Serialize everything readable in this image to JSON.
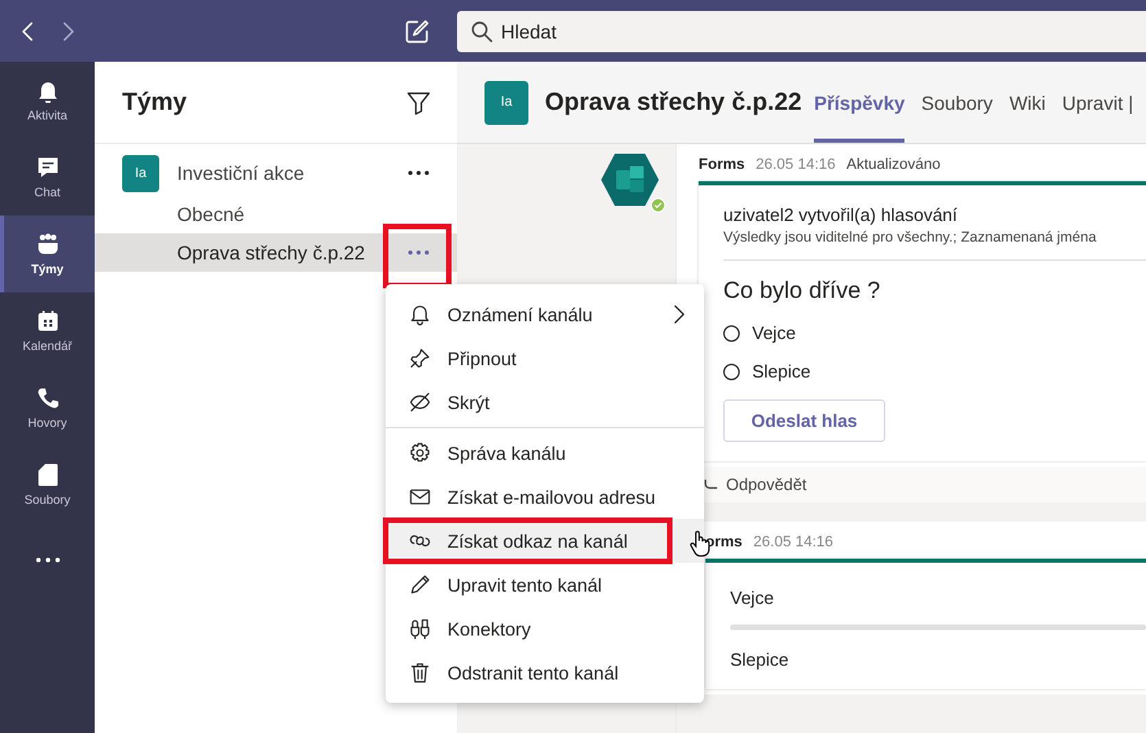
{
  "top_bar": {
    "search": {
      "placeholder": "Hledat"
    }
  },
  "rail": [
    {
      "kind": "activity",
      "label": "Aktivita",
      "selected": false
    },
    {
      "kind": "chat",
      "label": "Chat",
      "selected": false
    },
    {
      "kind": "teams",
      "label": "Týmy",
      "selected": true
    },
    {
      "kind": "calendar",
      "label": "Kalendář",
      "selected": false
    },
    {
      "kind": "calls",
      "label": "Hovory",
      "selected": false
    },
    {
      "kind": "files",
      "label": "Soubory",
      "selected": false
    }
  ],
  "teams_panel": {
    "title": "Týmy",
    "teams": [
      {
        "initials": "Ia",
        "name": "Investiční akce",
        "channels": [
          {
            "name": "Obecné",
            "selected": false,
            "annotated": false
          },
          {
            "name": "Oprava střechy č.p.22",
            "selected": true,
            "annotated": true
          }
        ]
      }
    ]
  },
  "channel_header": {
    "initials": "Ia",
    "title": "Oprava střechy č.p.22",
    "tabs": [
      {
        "label": "Příspěvky",
        "selected": true
      },
      {
        "label": "Soubory",
        "selected": false
      },
      {
        "label": "Wiki",
        "selected": false
      },
      {
        "label": "Upravit |",
        "selected": false
      }
    ]
  },
  "posts": [
    {
      "author": "Forms",
      "time": "26.05 14:16",
      "status": "Aktualizováno",
      "creator_line": "uzivatel2 vytvořil(a) hlasování",
      "note": "Výsledky jsou viditelné pro všechny.; Zaznamenaná jména",
      "question": "Co bylo dříve ?",
      "options": [
        {
          "label": "Vejce",
          "selected": false
        },
        {
          "label": "Slepice",
          "selected": false
        }
      ],
      "submit": "Odeslat hlas",
      "reply": "Odpovědět"
    },
    {
      "author": "orms",
      "time": "26.05 14:16",
      "results": [
        {
          "option": "Vejce",
          "level": 0
        },
        {
          "option": "Slepice"
        }
      ]
    }
  ],
  "context_menu": {
    "sections": [
      [
        {
          "kind": "notifications",
          "label": "Oznámení kanálu",
          "submenu": true,
          "hovered": false,
          "annotated": false
        },
        {
          "kind": "pin",
          "label": "Připnout",
          "submenu": false,
          "hovered": false,
          "annotated": false
        },
        {
          "kind": "hide",
          "label": "Skrýt",
          "submenu": false,
          "hovered": false,
          "annotated": false
        }
      ],
      [
        {
          "kind": "settings",
          "label": "Správa kanálu",
          "submenu": false,
          "hovered": false,
          "annotated": false
        },
        {
          "kind": "email",
          "label": "Získat e-mailovou adresu",
          "submenu": false,
          "hovered": false,
          "annotated": false
        },
        {
          "kind": "link",
          "label": "Získat odkaz na kanál",
          "submenu": false,
          "hovered": true,
          "annotated": true
        },
        {
          "kind": "edit",
          "label": "Upravit tento kanál",
          "submenu": false,
          "hovered": false,
          "annotated": false
        },
        {
          "kind": "connectors",
          "label": "Konektory",
          "submenu": false,
          "hovered": false,
          "annotated": false
        },
        {
          "kind": "delete",
          "label": "Odstranit tento kanál",
          "submenu": false,
          "hovered": false,
          "annotated": false
        }
      ]
    ]
  }
}
